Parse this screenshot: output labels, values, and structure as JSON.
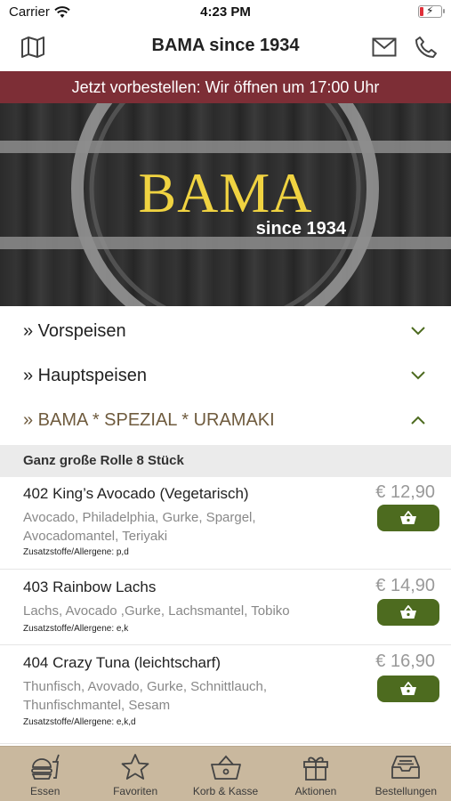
{
  "status_bar": {
    "carrier": "Carrier",
    "time": "4:23 PM"
  },
  "nav": {
    "title": "BAMA since 1934",
    "map_icon": "map-icon",
    "mail_icon": "envelope-icon",
    "phone_icon": "phone-icon"
  },
  "hero": {
    "banner": "Jetzt vorbestellen: Wir öffnen um 17:00 Uhr",
    "logo_word": "BAMA",
    "logo_sub": "since 1934",
    "colors": {
      "banner": "#7d2e36",
      "logo": "#f0d341"
    }
  },
  "categories": [
    {
      "label": "» Vorspeisen",
      "expanded": false
    },
    {
      "label": "» Hauptspeisen",
      "expanded": false
    },
    {
      "label": "» BAMA * SPEZIAL * URAMAKI",
      "expanded": true
    }
  ],
  "section": {
    "title": "Ganz große Rolle 8 Stück"
  },
  "items": [
    {
      "name": "402 King’s Avocado (Vegetarisch)",
      "desc": "Avocado, Philadelphia, Gurke, Spargel, Avocadomantel, Teriyaki",
      "allergen": "Zusatzstoffe/Allergene: p,d",
      "price": "€ 12,90"
    },
    {
      "name": "403 Rainbow Lachs",
      "desc": "Lachs, Avocado ,Gurke, Lachsmantel, Tobiko",
      "allergen": "Zusatzstoffe/Allergene: e,k",
      "price": "€ 14,90"
    },
    {
      "name": "404 Crazy Tuna (leichtscharf)",
      "desc": "Thunfisch, Avovado, Gurke, Schnittlauch, Thunfischmantel, Sesam",
      "allergen": "Zusatzstoffe/Allergene: e,k,d",
      "price": "€ 16,90"
    }
  ],
  "tabs": [
    {
      "label": "Essen",
      "icon": "burger-drink-icon"
    },
    {
      "label": "Favoriten",
      "icon": "star-icon"
    },
    {
      "label": "Korb & Kasse",
      "icon": "basket-icon"
    },
    {
      "label": "Aktionen",
      "icon": "gift-icon"
    },
    {
      "label": "Bestellungen",
      "icon": "inbox-tray-icon"
    }
  ],
  "colors": {
    "accent_green": "#4d6b1f",
    "tabbar": "#c9b89e",
    "active_category": "#6f5b3e"
  }
}
